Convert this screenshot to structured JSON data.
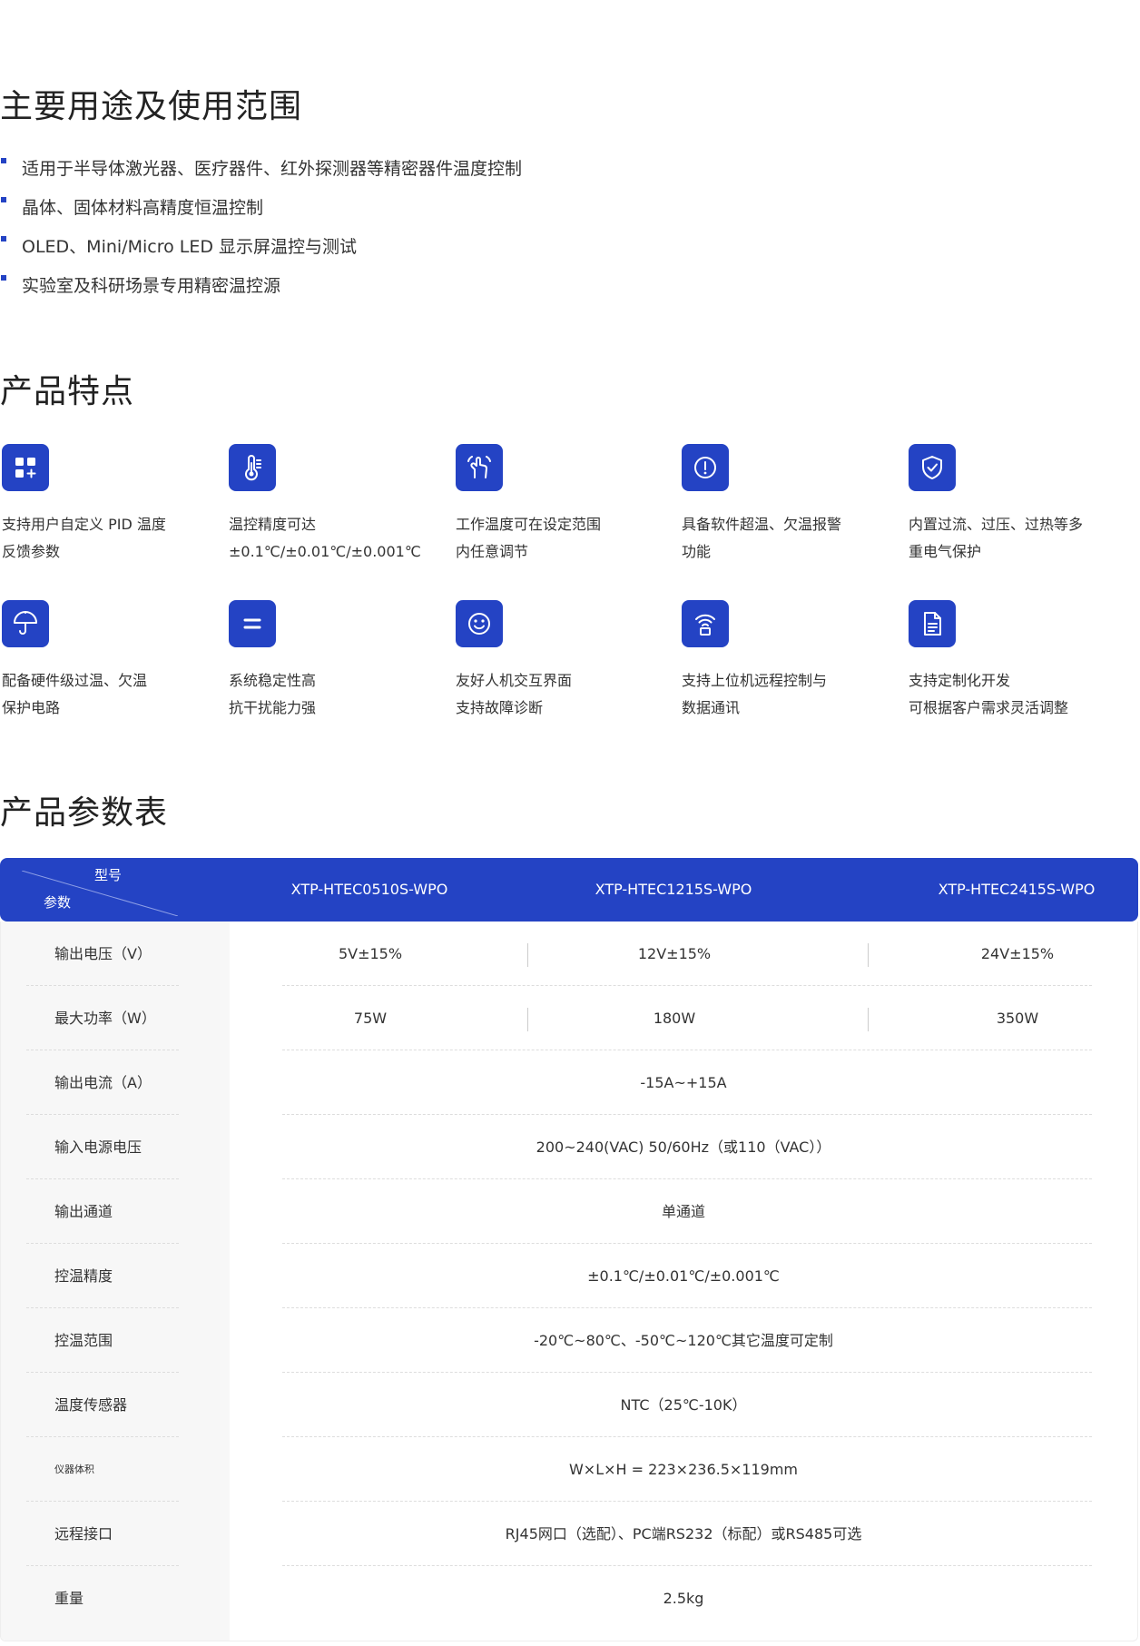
{
  "usage": {
    "title": "主要用途及使用范围",
    "items": [
      "适用于半导体激光器、医疗器件、红外探测器等精密器件温度控制",
      "晶体、固体材料高精度恒温控制",
      "OLED、Mini/Micro LED 显示屏温控与测试",
      "实验室及科研场景专用精密温控源"
    ]
  },
  "features": {
    "title": "产品特点",
    "items": [
      {
        "icon": "apps-add-icon",
        "line1": "支持用户自定义 PID 温度",
        "line2": "反馈参数"
      },
      {
        "icon": "thermometer-icon",
        "line1": "温控精度可达",
        "line2": "±0.1℃/±0.01℃/±0.001℃"
      },
      {
        "icon": "hand-adjust-icon",
        "line1": "工作温度可在设定范围",
        "line2": "内任意调节"
      },
      {
        "icon": "alert-circle-icon",
        "line1": "具备软件超温、欠温报警",
        "line2": "功能"
      },
      {
        "icon": "shield-check-icon",
        "line1": "内置过流、过压、过热等多",
        "line2": "重电气保护"
      },
      {
        "icon": "umbrella-icon",
        "line1": "配备硬件级过温、欠温",
        "line2": "保护电路"
      },
      {
        "icon": "equals-icon",
        "line1": "系统稳定性高",
        "line2": "抗干扰能力强"
      },
      {
        "icon": "smiley-icon",
        "line1": "友好人机交互界面",
        "line2": "支持故障诊断"
      },
      {
        "icon": "remote-signal-icon",
        "line1": "支持上位机远程控制与",
        "line2": "数据通讯"
      },
      {
        "icon": "document-icon",
        "line1": "支持定制化开发",
        "line2": "可根据客户需求灵活调整"
      }
    ]
  },
  "params": {
    "title": "产品参数表",
    "header_model": "型号",
    "header_param": "参数",
    "models": [
      "XTP-HTEC0510S-WPO",
      "XTP-HTEC1215S-WPO",
      "XTP-HTEC2415S-WPO"
    ],
    "rows": [
      {
        "label": "输出电压（V）",
        "values": [
          "5V±15%",
          "12V±15%",
          "24V±15%"
        ]
      },
      {
        "label": "最大功率（W）",
        "values": [
          "75W",
          "180W",
          "350W"
        ]
      },
      {
        "label": "输出电流（A）",
        "value": "-15A~+15A"
      },
      {
        "label": "输入电源电压",
        "value": "200~240(VAC) 50/60Hz（或110（VAC））"
      },
      {
        "label": "输出通道",
        "value": "单通道"
      },
      {
        "label": "控温精度",
        "value": "±0.1℃/±0.01℃/±0.001℃"
      },
      {
        "label": "控温范围",
        "value": "-20℃~80℃、-50℃~120℃其它温度可定制"
      },
      {
        "label": "温度传感器",
        "value": "NTC（25℃-10K）"
      },
      {
        "label": "仪器体积",
        "value": "W×L×H = 223×236.5×119mm"
      },
      {
        "label": "远程接口",
        "value": "RJ45网口（选配）、PC端RS232（标配）或RS485可选"
      },
      {
        "label": "重量",
        "value": "2.5kg"
      }
    ]
  },
  "colors": {
    "accent": "#2443c4",
    "label_bg": "#f7f7f7",
    "text": "#333333"
  }
}
